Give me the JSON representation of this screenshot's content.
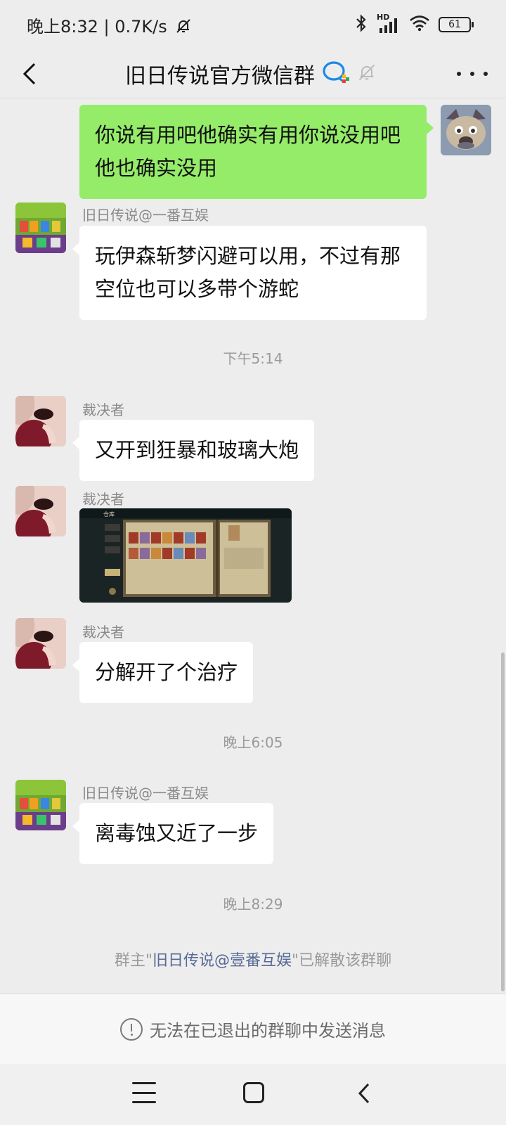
{
  "status_bar": {
    "time": "晚上8:32",
    "network_speed": "0.7K/s",
    "signal_label": "HD",
    "battery_level": "61"
  },
  "header": {
    "title": "旧日传说官方微信群"
  },
  "messages": [
    {
      "type": "text",
      "outgoing": true,
      "text": "你说有用吧他确实有用你说没用吧他也确实没用"
    },
    {
      "type": "text",
      "outgoing": false,
      "sender": "旧日传说@一番互娱",
      "text": "玩伊森斩梦闪避可以用，不过有那空位也可以多带个游蛇"
    },
    {
      "type": "time",
      "text": "下午5:14"
    },
    {
      "type": "text",
      "outgoing": false,
      "sender": "裁决者",
      "text": "又开到狂暴和玻璃大炮"
    },
    {
      "type": "image",
      "outgoing": false,
      "sender": "裁决者",
      "text": "仓库"
    },
    {
      "type": "text",
      "outgoing": false,
      "sender": "裁决者",
      "text": "分解开了个治疗"
    },
    {
      "type": "time",
      "text": "晚上6:05"
    },
    {
      "type": "text",
      "outgoing": false,
      "sender": "旧日传说@一番互娱",
      "text": "离毒蚀又近了一步"
    },
    {
      "type": "time",
      "text": "晚上8:29"
    }
  ],
  "system_notice": {
    "prefix": "群主\"",
    "owner": "旧日传说@壹番互娱",
    "suffix": "\"已解散该群聊"
  },
  "footer": {
    "disabled_notice": "无法在已退出的群聊中发送消息"
  },
  "colors": {
    "outgoing_bubble": "#95ec69",
    "incoming_bubble": "#ffffff",
    "background": "#ededed",
    "link": "#576b95"
  }
}
